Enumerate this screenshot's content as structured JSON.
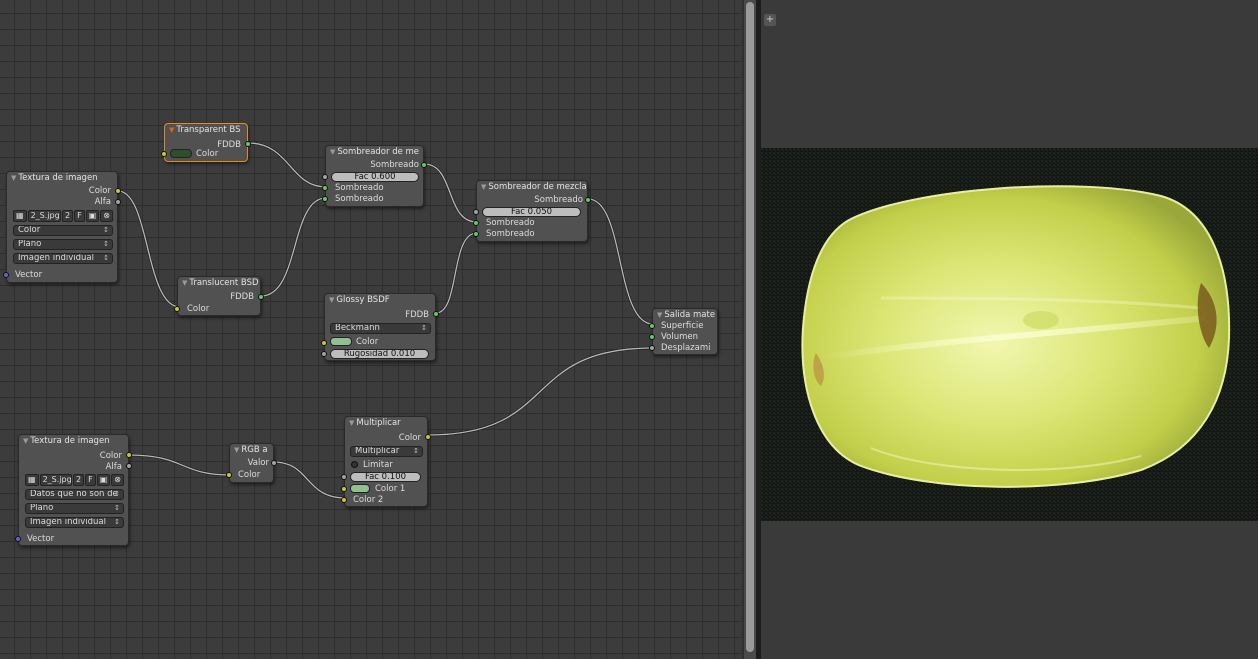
{
  "node_editor": {
    "nodes": {
      "tex1": {
        "title": "Textura de imagen",
        "out_color": "Color",
        "out_alpha": "Alfa",
        "image_name": "2_S.jpg",
        "users": "2",
        "fake": "F",
        "color_space": "Color",
        "projection": "Plano",
        "extension": "Imagen individual",
        "in_vector": "Vector"
      },
      "transparent": {
        "title": "Transparent BS",
        "out": "FDDB",
        "in_color": "Color",
        "color": "#2f4f2a"
      },
      "translucent": {
        "title": "Translucent BSD",
        "out": "FDDB",
        "in_color": "Color"
      },
      "mix1": {
        "title": "Sombreador de me",
        "out": "Sombreado",
        "fac": "Fac 0.600",
        "in1": "Sombreado",
        "in2": "Sombreado"
      },
      "mix2": {
        "title": "Sombreador de mezcla",
        "out": "Sombreado",
        "fac": "Fac 0.050",
        "in1": "Sombreado",
        "in2": "Sombreado"
      },
      "glossy": {
        "title": "Glossy BSDF",
        "out": "FDDB",
        "distribution": "Beckmann",
        "in_color": "Color",
        "roughness": "Rugosidad 0.010",
        "color": "#8fc08f"
      },
      "output": {
        "title": "Salida mate",
        "in_surface": "Superficie",
        "in_volume": "Volumen",
        "in_displacement": "Desplazami"
      },
      "tex2": {
        "title": "Textura de imagen",
        "out_color": "Color",
        "out_alpha": "Alfa",
        "image_name": "2_S.jpg",
        "users": "2",
        "fake": "F",
        "color_space": "Datos que no son de",
        "projection": "Plano",
        "extension": "Imagen individual",
        "in_vector": "Vector"
      },
      "rgba": {
        "title": "RGB a",
        "out_value": "Valor",
        "in_color": "Color"
      },
      "math": {
        "title": "Multiplicar",
        "out_color": "Color",
        "operation": "Multiplicar",
        "clamp": "Limitar",
        "fac": "Fac 0.100",
        "in_color1": "Color 1",
        "in_color2": "Color 2",
        "color": "#8fc08f"
      }
    }
  },
  "viewer": {
    "plus_label": "+"
  },
  "colors": {
    "selected_outline": "#e08a2a",
    "socket_color": "#c7c729",
    "socket_shader": "#62c862",
    "socket_float": "#a1a1a1",
    "socket_vector": "#6363c7"
  }
}
